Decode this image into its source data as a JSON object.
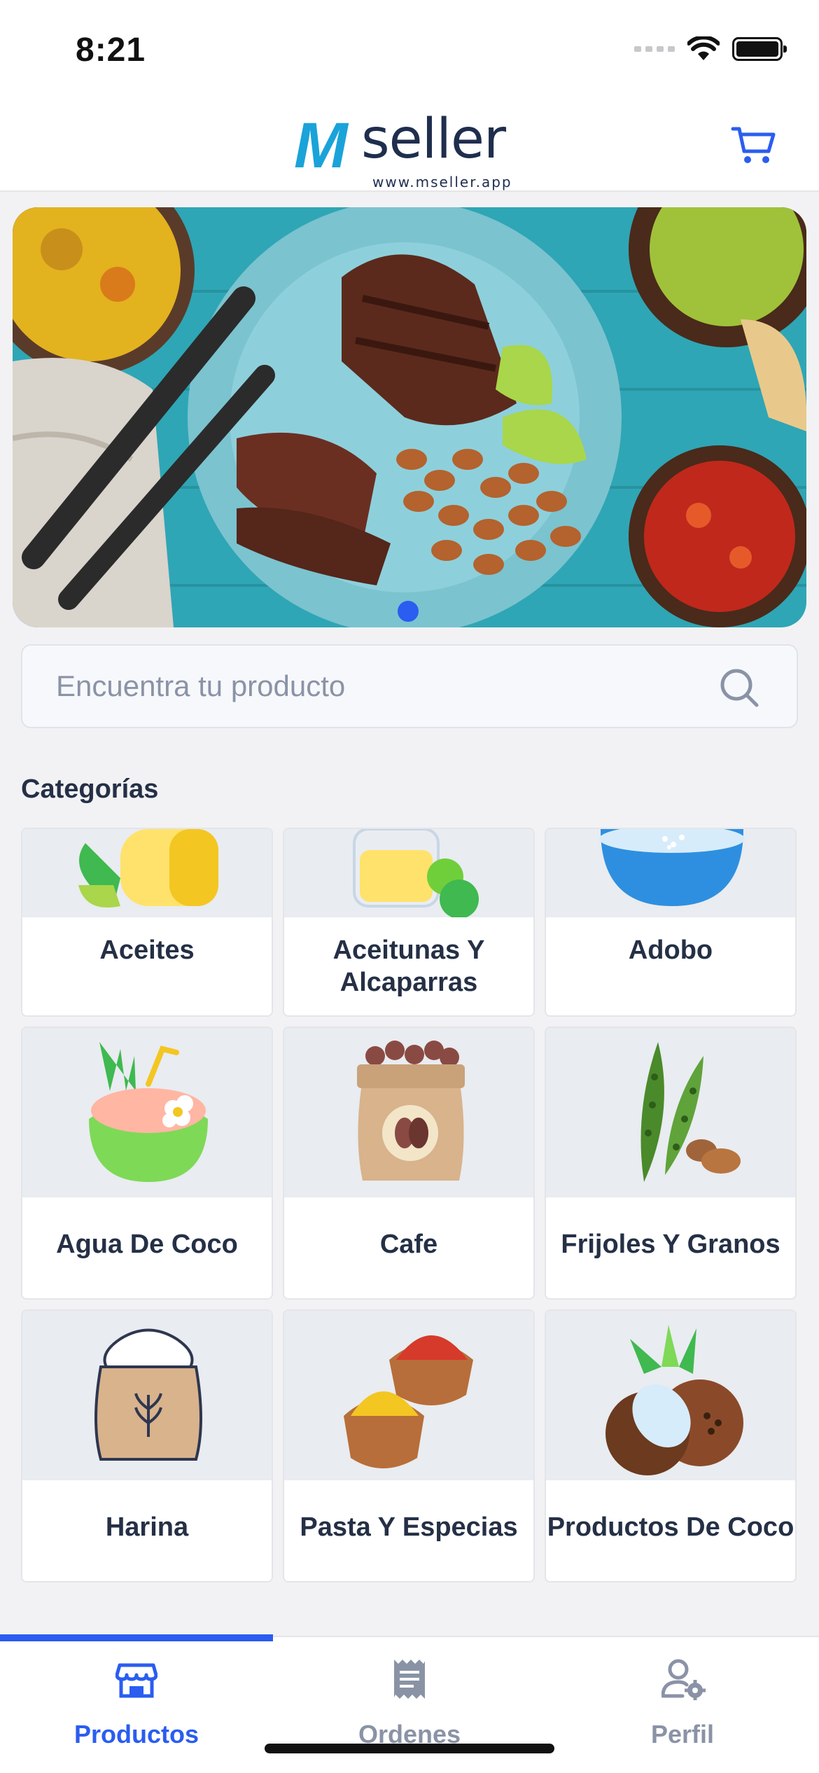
{
  "status_bar": {
    "time": "8:21"
  },
  "header": {
    "logo_mark": "M",
    "logo_word": "seller",
    "logo_url": "www.mseller.app",
    "cart_icon": "cart-icon"
  },
  "banner": {
    "image": "food-plate-steak-beans",
    "active_slide": 1
  },
  "search": {
    "placeholder": "Encuentra tu producto",
    "value": ""
  },
  "categories": {
    "title": "Categorías",
    "items": [
      {
        "label": "Aceites",
        "icon": "oil-icon"
      },
      {
        "label": "Aceitunas Y Alcaparras",
        "icon": "olives-jar-icon"
      },
      {
        "label": "Adobo",
        "icon": "seasoning-bowl-icon"
      },
      {
        "label": "Agua De Coco",
        "icon": "coconut-drink-icon"
      },
      {
        "label": "Cafe",
        "icon": "coffee-bag-icon"
      },
      {
        "label": "Frijoles Y Granos",
        "icon": "beans-pod-icon"
      },
      {
        "label": "Harina",
        "icon": "flour-sack-icon"
      },
      {
        "label": "Pasta Y Especias",
        "icon": "spice-bowls-icon"
      },
      {
        "label": "Productos De Coco",
        "icon": "coconut-icon"
      }
    ]
  },
  "bottom_nav": {
    "items": [
      {
        "label": "Productos",
        "icon": "store-icon",
        "active": true
      },
      {
        "label": "Ordenes",
        "icon": "receipt-icon",
        "active": false
      },
      {
        "label": "Perfil",
        "icon": "user-settings-icon",
        "active": false
      }
    ],
    "active_color": "#2a5df0",
    "inactive_color": "#8a93a6"
  }
}
